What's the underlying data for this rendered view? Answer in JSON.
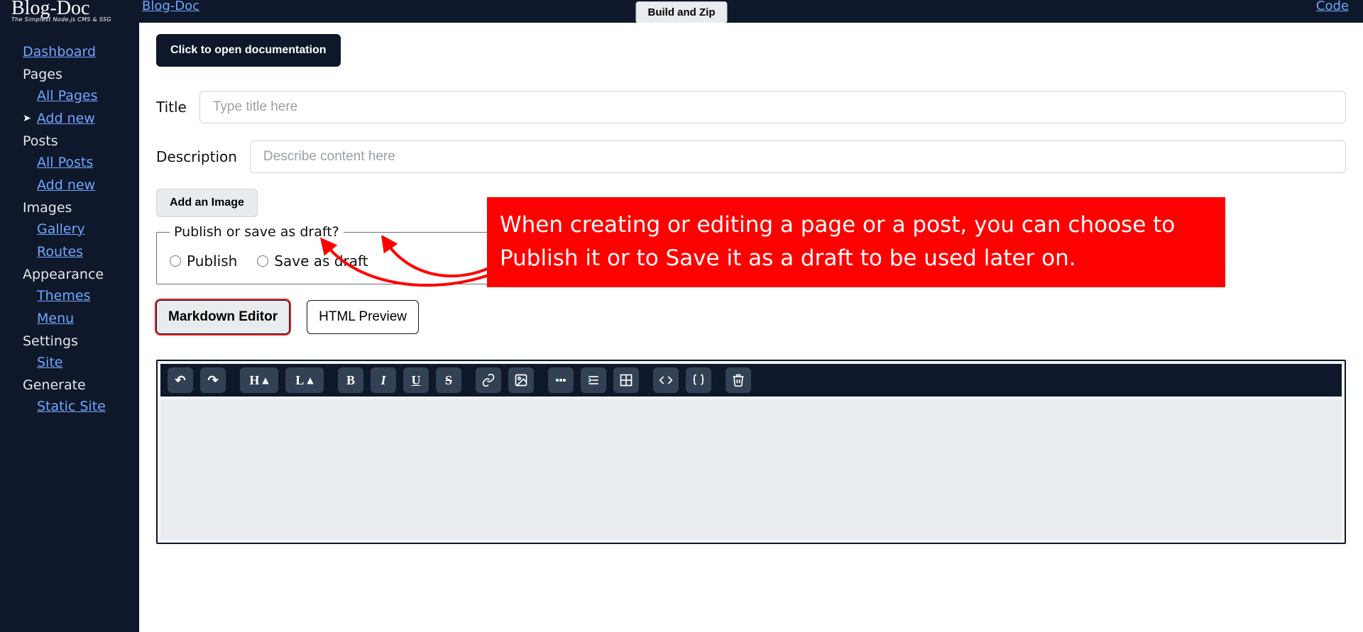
{
  "header": {
    "brand_name": "Blog-Doc",
    "brand_sub": "The Simplest Node.js CMS & SSG",
    "blogdoc_link": "Blog-Doc",
    "build_zip": "Build and Zip",
    "code_link": "Code"
  },
  "sidebar": {
    "dashboard": "Dashboard",
    "pages_label": "Pages",
    "all_pages": "All Pages",
    "add_new_page": "Add new",
    "posts_label": "Posts",
    "all_posts": "All Posts",
    "add_new_post": "Add new",
    "images_label": "Images",
    "gallery": "Gallery",
    "routes": "Routes",
    "appearance_label": "Appearance",
    "themes": "Themes",
    "menu": "Menu",
    "settings_label": "Settings",
    "site": "Site",
    "generate_label": "Generate",
    "static_site": "Static Site"
  },
  "main": {
    "doc_button": "Click to open documentation",
    "title_label": "Title",
    "title_placeholder": "Type title here",
    "desc_label": "Description",
    "desc_placeholder": "Describe content here",
    "add_image": "Add an Image",
    "fieldset_legend": "Publish or save as draft?",
    "radio_publish": "Publish",
    "radio_draft": "Save as draft",
    "tab_md": "Markdown Editor",
    "tab_html": "HTML Preview",
    "callout": "When creating or editing a page or a post, you can choose to Publish it or to Save it as a draft to be used later on."
  },
  "toolbar": {
    "undo": "↶",
    "redo": "↷",
    "bold": "B",
    "italic": "I",
    "underline": "U",
    "strike": "S",
    "heading": "H",
    "line": "L"
  }
}
